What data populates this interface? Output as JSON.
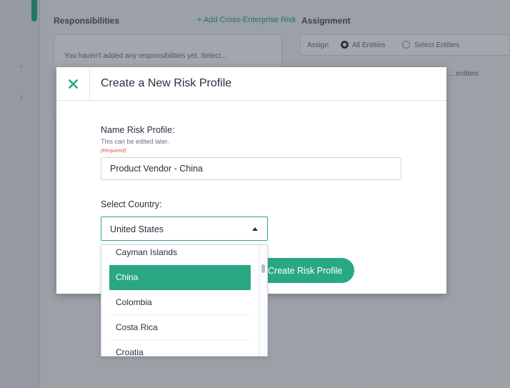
{
  "background": {
    "responsibilities_title": "Responsibilities",
    "add_link": "+ Add Cross-Enterprise Risk",
    "card_text": "You haven't added any responsibilities yet. Select...",
    "assignment_title": "Assignment",
    "assign_label": "Assign",
    "all_entities": "All Entities",
    "select_entities": "Select Entities",
    "hint_right": "...entities"
  },
  "modal": {
    "title": "Create a New Risk Profile",
    "name_label": "Name Risk Profile:",
    "name_hint": "This can be edited later.",
    "name_required": "(Required)",
    "name_value": "Product Vendor - China",
    "country_label": "Select Country:",
    "country_selected": "United States",
    "submit_label": "Create Risk Profile"
  },
  "dropdown": {
    "options": [
      "Cayman Islands",
      "China",
      "Colombia",
      "Costa Rica",
      "Croatia"
    ],
    "highlighted": "China"
  },
  "colors": {
    "accent": "#2aa884",
    "text": "#263040",
    "required": "#d9534f"
  }
}
